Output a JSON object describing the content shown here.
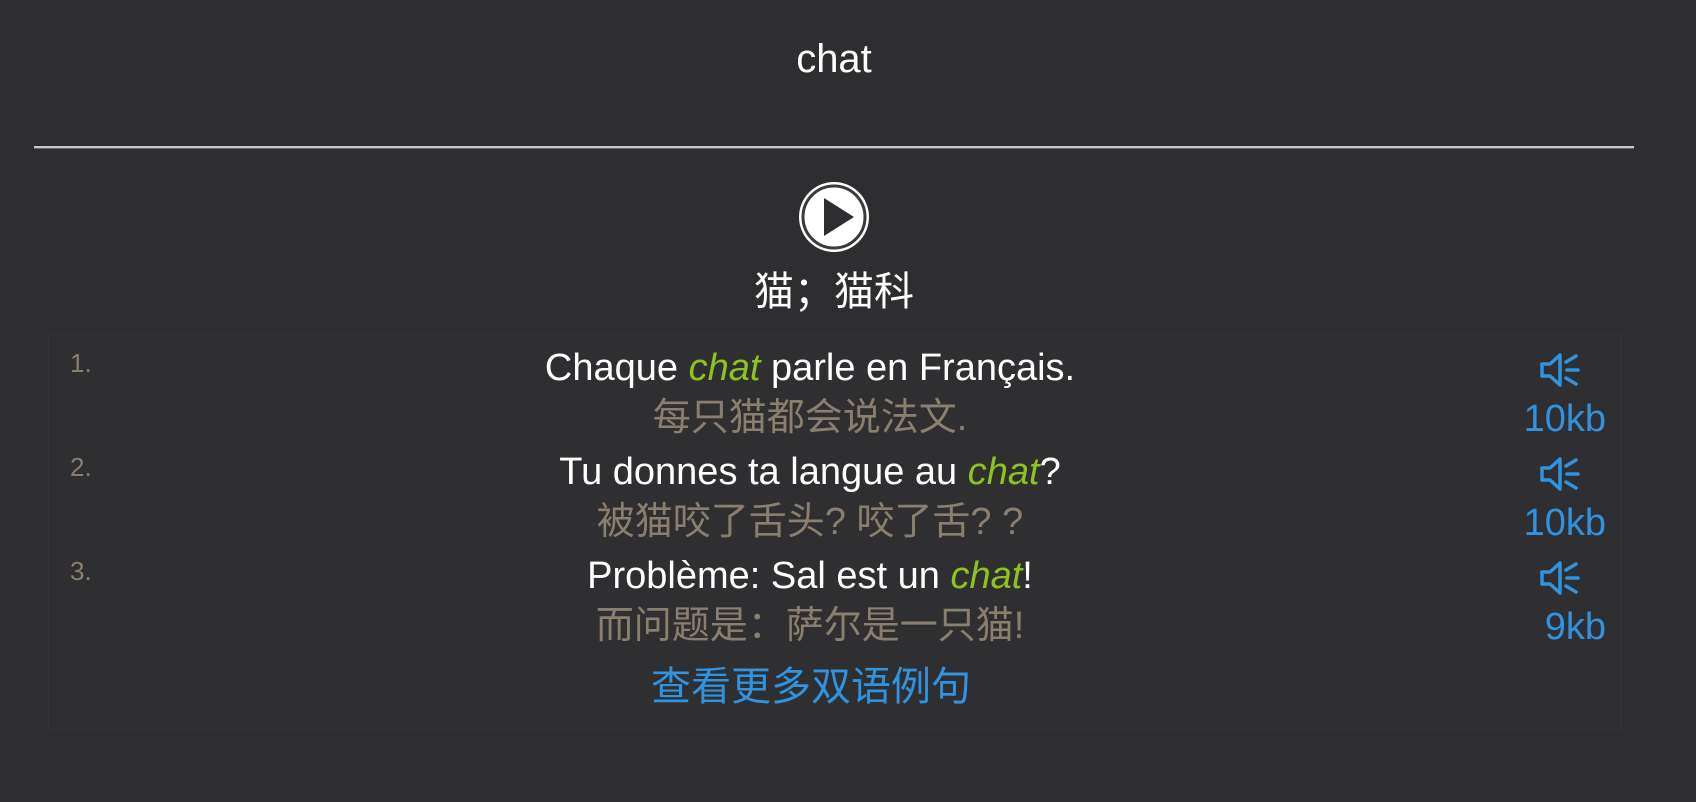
{
  "word": "chat",
  "definition": "猫；猫科",
  "play_icon": "play-circle-icon",
  "colors": {
    "background": "#2e2e30",
    "highlight": "#8ec31f",
    "link": "#2f93e0",
    "translation": "#8a7f6e"
  },
  "examples": [
    {
      "number": "1.",
      "fr_before": "Chaque ",
      "fr_highlight": "chat",
      "fr_after": " parle en Français.",
      "zh": "每只猫都会说法文.",
      "audio_icon": "speaker-icon",
      "audio_size": "10kb"
    },
    {
      "number": "2.",
      "fr_before": "Tu donnes ta langue au ",
      "fr_highlight": "chat",
      "fr_after": "?",
      "zh": "被猫咬了舌头?  咬了舌? ?",
      "audio_icon": "speaker-icon",
      "audio_size": "10kb"
    },
    {
      "number": "3.",
      "fr_before": "Problème: Sal est un ",
      "fr_highlight": "chat",
      "fr_after": "!",
      "zh": "而问题是：萨尔是一只猫!",
      "audio_icon": "speaker-icon",
      "audio_size": "9kb"
    }
  ],
  "more_examples_label": "查看更多双语例句"
}
